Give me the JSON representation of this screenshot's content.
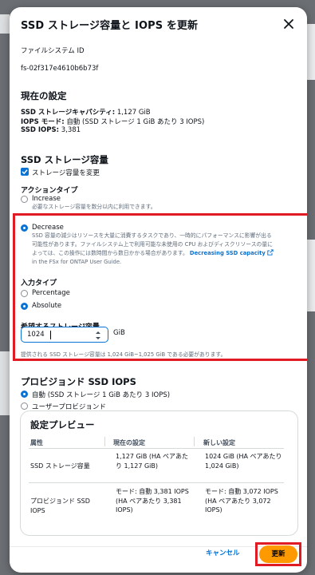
{
  "modal": {
    "title": "SSD ストレージ容量と IOPS を更新"
  },
  "file_system": {
    "label": "ファイルシステム ID",
    "value": "fs-02f317e4610b6b73f"
  },
  "current_settings": {
    "heading": "現在の設定",
    "capacity_label": "SSD ストレージキャパシティ:",
    "capacity_value": "1,127 GiB",
    "iops_mode_label": "IOPS モード:",
    "iops_mode_value": "自動 (SSD ストレージ 1 GiB あたり 3 IOPS)",
    "ssd_iops_label": "SSD IOPS:",
    "ssd_iops_value": "3,381"
  },
  "ssd_capacity": {
    "heading": "SSD ストレージ容量",
    "change_checkbox_label": "ストレージ容量を変更",
    "action_type_label": "アクションタイプ",
    "increase_label": "Increase",
    "increase_desc": "必要なストレージ容量を数分以内に利用できます。",
    "decrease_label": "Decrease",
    "decrease_desc_1": "SSD 容量の減少はリソースを大量に消費するタスクであり、一時的にパフォーマンスに影響が出る",
    "decrease_desc_2": "可能性があります。ファイルシステム上で利用可能な未使用の CPU およびディスクリソースの量に",
    "decrease_desc_3": "よっては、この操作には数時間から数日かかる場合があります。",
    "decrease_link": "Decreasing SSD capacity",
    "decrease_desc_4": "in the FSx for ONTAP User Guide.",
    "input_type_label": "入力タイプ",
    "percentage_label": "Percentage",
    "absolute_label": "Absolute",
    "desired_label": "希望するストレージ容量",
    "desired_value": "1024",
    "unit": "GiB",
    "constraint": "提供される SSD ストレージ容量は 1,024 GiB~1,025 GiB である必要があります。"
  },
  "provisioned_iops": {
    "heading": "プロビジョンド SSD IOPS",
    "auto_label": "自動 (SSD ストレージ 1 GiB あたり 3 IOPS)",
    "user_label": "ユーザープロビジョンド"
  },
  "preview": {
    "heading": "設定プレビュー",
    "columns": [
      "属性",
      "現在の設定",
      "新しい設定"
    ],
    "rows": [
      {
        "attr": "SSD ストレージ容量",
        "current": "1,127 GiB (HA ペアあたり 1,127 GiB)",
        "new": "1024 GiB (HA ペアあたり 1,024 GiB)"
      },
      {
        "attr": "プロビジョンド SSD IOPS",
        "current": "モード: 自動 3,381 IOPS (HA ペアあたり 3,381 IOPS)",
        "new": "モード: 自動 3,072 IOPS (HA ペアあたり 3,072 IOPS)"
      }
    ]
  },
  "footer": {
    "cancel": "キャンセル",
    "update": "更新"
  },
  "colors": {
    "accent": "#0972d3",
    "primary_button": "#ff9900",
    "highlight": "#e01b24"
  }
}
